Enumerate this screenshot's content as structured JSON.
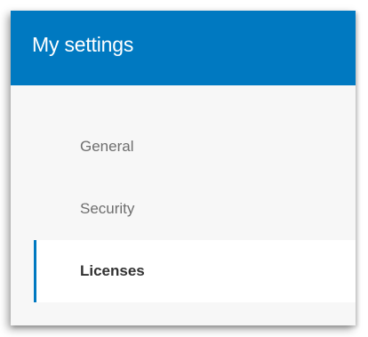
{
  "header": {
    "title": "My settings"
  },
  "nav": {
    "items": [
      {
        "label": "General",
        "active": false
      },
      {
        "label": "Security",
        "active": false
      },
      {
        "label": "Licenses",
        "active": true
      }
    ]
  },
  "colors": {
    "header_bg": "#0079c1",
    "active_indicator": "#0079c1",
    "panel_bg": "#f7f7f7"
  }
}
